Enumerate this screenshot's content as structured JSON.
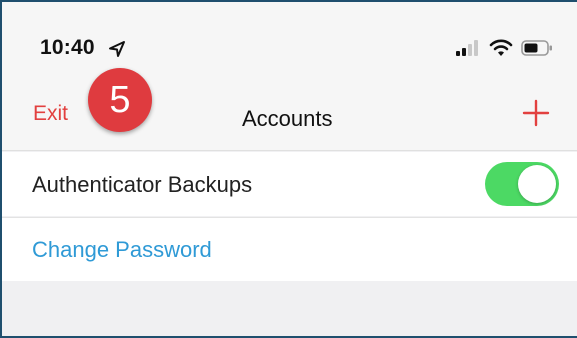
{
  "status_bar": {
    "time": "10:40",
    "location_icon": "location-arrow-icon",
    "signal_icon": "cellular-signal-icon",
    "wifi_icon": "wifi-icon",
    "battery_icon": "battery-icon"
  },
  "step_badge": {
    "number": "5",
    "color": "#df3b3f"
  },
  "nav": {
    "exit_label": "Exit",
    "title": "Accounts",
    "add_icon": "plus-icon",
    "accent_color": "#e2403f"
  },
  "settings": {
    "rows": [
      {
        "label": "Authenticator Backups",
        "toggle_on": true,
        "toggle_color": "#4cd964"
      },
      {
        "label": "Change Password",
        "link_color": "#2f9ad6"
      }
    ]
  }
}
